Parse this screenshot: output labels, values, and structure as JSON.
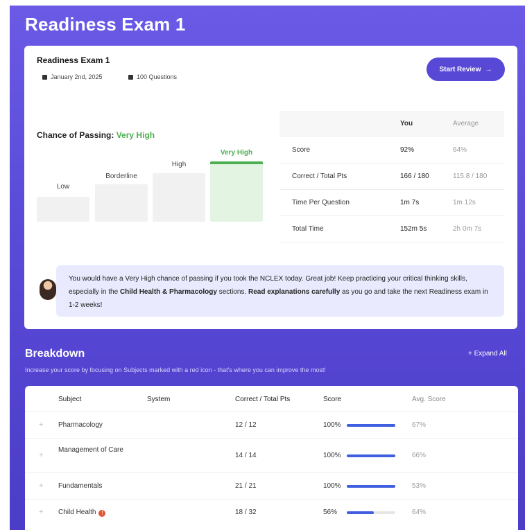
{
  "page": {
    "title": "Readiness Exam 1"
  },
  "card": {
    "title": "Readiness Exam 1",
    "date": "January 2nd, 2025",
    "questions": "100 Questions",
    "start_review": "Start Review",
    "arrow": "→"
  },
  "chance": {
    "label": "Chance of Passing:",
    "value": "Very High",
    "levels": [
      "Low",
      "Borderline",
      "High",
      "Very High"
    ]
  },
  "stats": {
    "headers": {
      "you": "You",
      "average": "Average"
    },
    "rows": [
      {
        "label": "Score",
        "you": "92%",
        "avg": "64%"
      },
      {
        "label": "Correct / Total Pts",
        "you": "166 / 180",
        "avg": "115.8 / 180"
      },
      {
        "label": "Time Per Question",
        "you": "1m 7s",
        "avg": "1m 12s"
      },
      {
        "label": "Total Time",
        "you": "152m 5s",
        "avg": "2h 0m 7s"
      }
    ]
  },
  "tip": {
    "part1": "You would have a Very High chance of passing if you took the NCLEX today. Great job! Keep practicing your critical thinking skills, especially in the ",
    "bold1": "Child Health & Pharmacology",
    "part2": " sections. ",
    "bold2": "Read explanations carefully",
    "part3": " as you go and take the next Readiness exam in 1-2 weeks!"
  },
  "breakdown": {
    "title": "Breakdown",
    "subtitle": "Increase your score by focusing on Subjects marked with a red icon - that's where you can improve the most!",
    "expand_all": "+ Expand All",
    "headers": {
      "subject": "Subject",
      "system": "System",
      "correct": "Correct / Total Pts",
      "score": "Score",
      "avg": "Avg. Score"
    },
    "rows": [
      {
        "subject": "Pharmacology",
        "correct": "12 / 12",
        "score": "100%",
        "score_value": 1.0,
        "avg": "67%",
        "flag": ""
      },
      {
        "subject": "Management of Care",
        "correct": "14 / 14",
        "score": "100%",
        "score_value": 1.0,
        "avg": "66%",
        "flag": ""
      },
      {
        "subject": "Fundamentals",
        "correct": "21 / 21",
        "score": "100%",
        "score_value": 1.0,
        "avg": "53%",
        "flag": ""
      },
      {
        "subject": "Child Health",
        "correct": "18 / 32",
        "score": "56%",
        "score_value": 0.56,
        "avg": "64%",
        "flag": "!"
      }
    ]
  },
  "colors": {
    "brand": "#5748d6",
    "success": "#4caf50",
    "bar": "#3f5ee0",
    "alert": "#e05535"
  }
}
